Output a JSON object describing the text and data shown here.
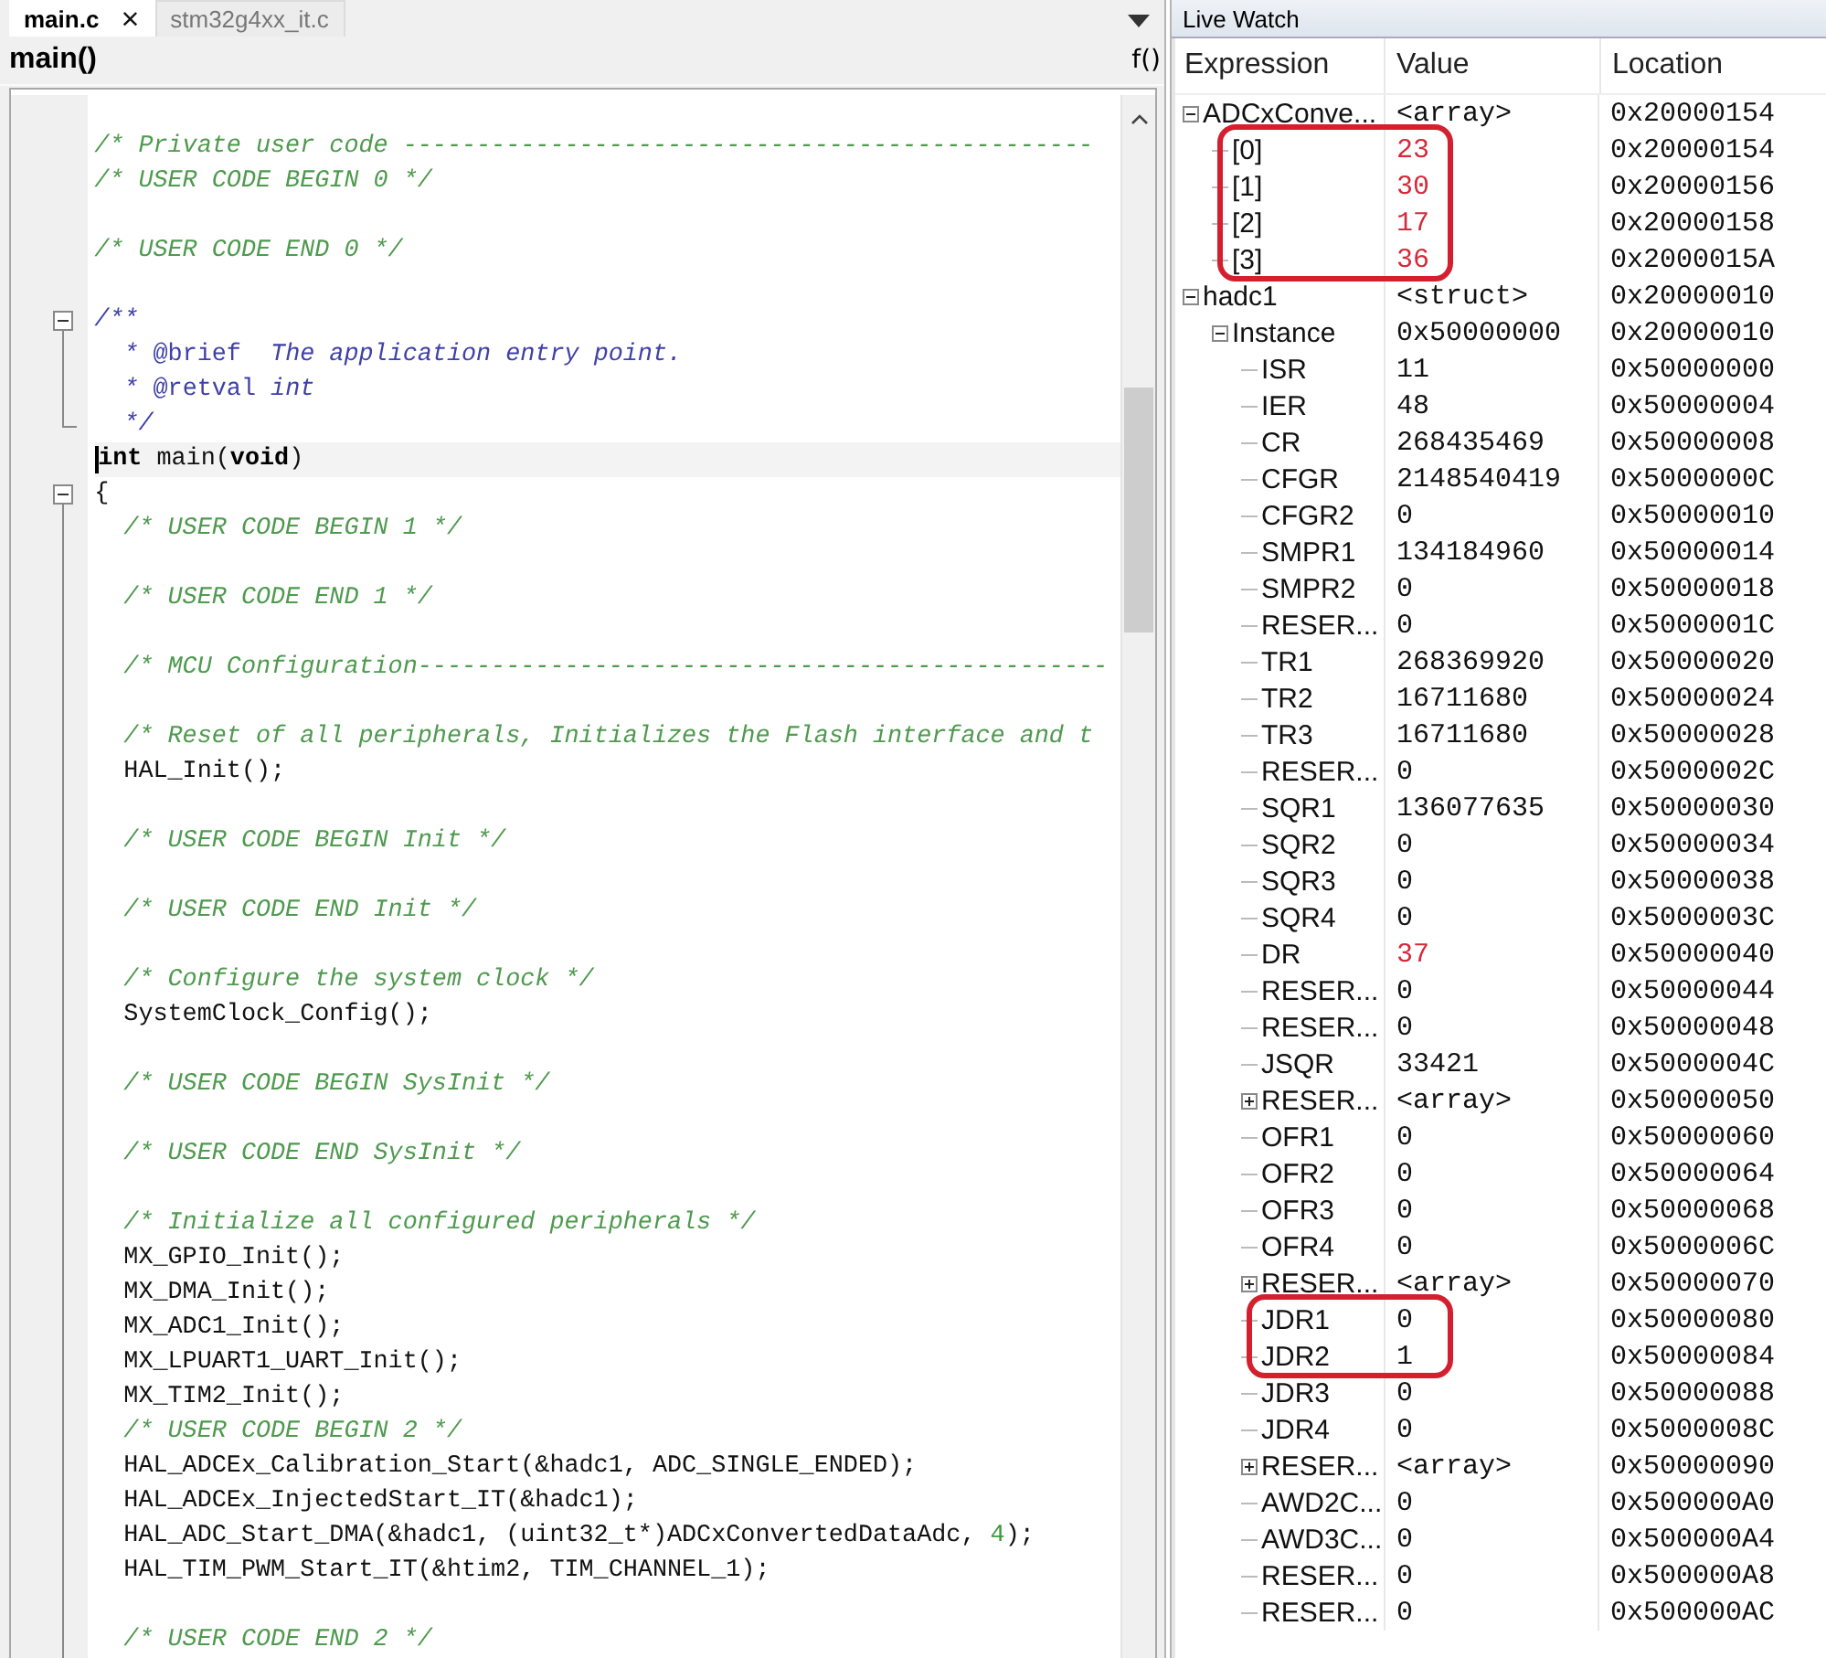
{
  "editor": {
    "tabs": [
      {
        "label": "main.c",
        "close": "×",
        "selected": true
      },
      {
        "label": "stm32g4xx_it.c",
        "selected": false
      }
    ],
    "function_name": "main()",
    "function_button": "f()",
    "lines": [
      {
        "kind": "blank",
        "current": false
      },
      {
        "kind": "text",
        "current": false,
        "segments": [
          {
            "kind": "comment",
            "text": "/* Private user code -----------------------------------------------"
          }
        ]
      },
      {
        "kind": "text",
        "current": false,
        "segments": [
          {
            "kind": "comment",
            "text": "/* USER CODE BEGIN 0 */"
          }
        ]
      },
      {
        "kind": "blank",
        "current": false
      },
      {
        "kind": "text",
        "current": false,
        "segments": [
          {
            "kind": "comment",
            "text": "/* USER CODE END 0 */"
          }
        ]
      },
      {
        "kind": "blank",
        "current": false
      },
      {
        "kind": "text",
        "current": false,
        "fold_open": true,
        "segments": [
          {
            "kind": "doc",
            "text": "/**"
          }
        ]
      },
      {
        "kind": "text",
        "current": false,
        "segments": [
          {
            "kind": "doc",
            "text": "  * "
          },
          {
            "kind": "doctag",
            "text": "@brief"
          },
          {
            "kind": "doc",
            "text": "  The application entry point."
          }
        ]
      },
      {
        "kind": "text",
        "current": false,
        "segments": [
          {
            "kind": "doc",
            "text": "  * "
          },
          {
            "kind": "doctag",
            "text": "@retval"
          },
          {
            "kind": "doc",
            "text": " int"
          }
        ]
      },
      {
        "kind": "text",
        "current": false,
        "fold_end": true,
        "segments": [
          {
            "kind": "doc",
            "text": "  */"
          }
        ]
      },
      {
        "kind": "text",
        "current": true,
        "segments": [
          {
            "kind": "keyword",
            "text": "int"
          },
          {
            "kind": "plain",
            "text": " main("
          },
          {
            "kind": "keyword",
            "text": "void"
          },
          {
            "kind": "plain",
            "text": ")"
          }
        ]
      },
      {
        "kind": "text",
        "current": false,
        "fold_open": true,
        "segments": [
          {
            "kind": "plain",
            "text": "{"
          }
        ]
      },
      {
        "kind": "text",
        "current": false,
        "segments": [
          {
            "kind": "comment",
            "text": "  /* USER CODE BEGIN 1 */"
          }
        ]
      },
      {
        "kind": "blank",
        "current": false
      },
      {
        "kind": "text",
        "current": false,
        "segments": [
          {
            "kind": "comment",
            "text": "  /* USER CODE END 1 */"
          }
        ]
      },
      {
        "kind": "blank",
        "current": false
      },
      {
        "kind": "text",
        "current": false,
        "segments": [
          {
            "kind": "comment",
            "text": "  /* MCU Configuration-----------------------------------------------"
          }
        ]
      },
      {
        "kind": "blank",
        "current": false
      },
      {
        "kind": "text",
        "current": false,
        "segments": [
          {
            "kind": "comment",
            "text": "  /* Reset of all peripherals, Initializes the Flash interface and t"
          }
        ]
      },
      {
        "kind": "text",
        "current": false,
        "segments": [
          {
            "kind": "plain",
            "text": "  HAL_Init();"
          }
        ]
      },
      {
        "kind": "blank",
        "current": false
      },
      {
        "kind": "text",
        "current": false,
        "segments": [
          {
            "kind": "comment",
            "text": "  /* USER CODE BEGIN Init */"
          }
        ]
      },
      {
        "kind": "blank",
        "current": false
      },
      {
        "kind": "text",
        "current": false,
        "segments": [
          {
            "kind": "comment",
            "text": "  /* USER CODE END Init */"
          }
        ]
      },
      {
        "kind": "blank",
        "current": false
      },
      {
        "kind": "text",
        "current": false,
        "segments": [
          {
            "kind": "comment",
            "text": "  /* Configure the system clock */"
          }
        ]
      },
      {
        "kind": "text",
        "current": false,
        "segments": [
          {
            "kind": "plain",
            "text": "  SystemClock_Config();"
          }
        ]
      },
      {
        "kind": "blank",
        "current": false
      },
      {
        "kind": "text",
        "current": false,
        "segments": [
          {
            "kind": "comment",
            "text": "  /* USER CODE BEGIN SysInit */"
          }
        ]
      },
      {
        "kind": "blank",
        "current": false
      },
      {
        "kind": "text",
        "current": false,
        "segments": [
          {
            "kind": "comment",
            "text": "  /* USER CODE END SysInit */"
          }
        ]
      },
      {
        "kind": "blank",
        "current": false
      },
      {
        "kind": "text",
        "current": false,
        "segments": [
          {
            "kind": "comment",
            "text": "  /* Initialize all configured peripherals */"
          }
        ]
      },
      {
        "kind": "text",
        "current": false,
        "segments": [
          {
            "kind": "plain",
            "text": "  MX_GPIO_Init();"
          }
        ]
      },
      {
        "kind": "text",
        "current": false,
        "segments": [
          {
            "kind": "plain",
            "text": "  MX_DMA_Init();"
          }
        ]
      },
      {
        "kind": "text",
        "current": false,
        "segments": [
          {
            "kind": "plain",
            "text": "  MX_ADC1_Init();"
          }
        ]
      },
      {
        "kind": "text",
        "current": false,
        "segments": [
          {
            "kind": "plain",
            "text": "  MX_LPUART1_UART_Init();"
          }
        ]
      },
      {
        "kind": "text",
        "current": false,
        "segments": [
          {
            "kind": "plain",
            "text": "  MX_TIM2_Init();"
          }
        ]
      },
      {
        "kind": "text",
        "current": false,
        "segments": [
          {
            "kind": "comment",
            "text": "  /* USER CODE BEGIN 2 */"
          }
        ]
      },
      {
        "kind": "text",
        "current": false,
        "segments": [
          {
            "kind": "plain",
            "text": "  HAL_ADCEx_Calibration_Start(&hadc1, ADC_SINGLE_ENDED);"
          }
        ]
      },
      {
        "kind": "text",
        "current": false,
        "segments": [
          {
            "kind": "plain",
            "text": "  HAL_ADCEx_InjectedStart_IT(&hadc1);"
          }
        ]
      },
      {
        "kind": "text",
        "current": false,
        "segments": [
          {
            "kind": "plain",
            "text": "  HAL_ADC_Start_DMA(&hadc1, (uint32_t*)ADCxConvertedDataAdc, "
          },
          {
            "kind": "number",
            "text": "4"
          },
          {
            "kind": "plain",
            "text": ");"
          }
        ]
      },
      {
        "kind": "text",
        "current": false,
        "segments": [
          {
            "kind": "plain",
            "text": "  HAL_TIM_PWM_Start_IT(&htim2, TIM_CHANNEL_1);"
          }
        ]
      },
      {
        "kind": "blank",
        "current": false
      },
      {
        "kind": "text",
        "current": false,
        "segments": [
          {
            "kind": "comment",
            "text": "  /* USER CODE END 2 */"
          }
        ]
      }
    ]
  },
  "watch": {
    "title": "Live Watch",
    "columns": [
      "Expression",
      "Value",
      "Location"
    ],
    "rows": [
      {
        "expression": "ADCxConve...",
        "value": "<array>",
        "location": "0x20000154",
        "changed": false,
        "circled": false,
        "expanded": true,
        "children": [
          {
            "expression": "[0]",
            "value": "23",
            "location": "0x20000154",
            "changed": true,
            "circled": true
          },
          {
            "expression": "[1]",
            "value": "30",
            "location": "0x20000156",
            "changed": true,
            "circled": true
          },
          {
            "expression": "[2]",
            "value": "17",
            "location": "0x20000158",
            "changed": true,
            "circled": true
          },
          {
            "expression": "[3]",
            "value": "36",
            "location": "0x2000015A",
            "changed": true,
            "circled": true
          }
        ]
      },
      {
        "expression": "hadc1",
        "value": "<struct>",
        "location": "0x20000010",
        "changed": false,
        "circled": false,
        "expanded": true,
        "children": [
          {
            "expression": "Instance",
            "value": "0x50000000",
            "location": "0x20000010",
            "changed": false,
            "circled": false,
            "expanded": true,
            "children": [
              {
                "expression": "ISR",
                "value": "11",
                "location": "0x50000000",
                "changed": false,
                "circled": false
              },
              {
                "expression": "IER",
                "value": "48",
                "location": "0x50000004",
                "changed": false,
                "circled": false
              },
              {
                "expression": "CR",
                "value": "268435469",
                "location": "0x50000008",
                "changed": false,
                "circled": false
              },
              {
                "expression": "CFGR",
                "value": "2148540419",
                "location": "0x5000000C",
                "changed": false,
                "circled": false
              },
              {
                "expression": "CFGR2",
                "value": "0",
                "location": "0x50000010",
                "changed": false,
                "circled": false
              },
              {
                "expression": "SMPR1",
                "value": "134184960",
                "location": "0x50000014",
                "changed": false,
                "circled": false
              },
              {
                "expression": "SMPR2",
                "value": "0",
                "location": "0x50000018",
                "changed": false,
                "circled": false
              },
              {
                "expression": "RESER...",
                "value": "0",
                "location": "0x5000001C",
                "changed": false,
                "circled": false
              },
              {
                "expression": "TR1",
                "value": "268369920",
                "location": "0x50000020",
                "changed": false,
                "circled": false
              },
              {
                "expression": "TR2",
                "value": "16711680",
                "location": "0x50000024",
                "changed": false,
                "circled": false
              },
              {
                "expression": "TR3",
                "value": "16711680",
                "location": "0x50000028",
                "changed": false,
                "circled": false
              },
              {
                "expression": "RESER...",
                "value": "0",
                "location": "0x5000002C",
                "changed": false,
                "circled": false
              },
              {
                "expression": "SQR1",
                "value": "136077635",
                "location": "0x50000030",
                "changed": false,
                "circled": false
              },
              {
                "expression": "SQR2",
                "value": "0",
                "location": "0x50000034",
                "changed": false,
                "circled": false
              },
              {
                "expression": "SQR3",
                "value": "0",
                "location": "0x50000038",
                "changed": false,
                "circled": false
              },
              {
                "expression": "SQR4",
                "value": "0",
                "location": "0x5000003C",
                "changed": false,
                "circled": false
              },
              {
                "expression": "DR",
                "value": "37",
                "location": "0x50000040",
                "changed": true,
                "circled": false
              },
              {
                "expression": "RESER...",
                "value": "0",
                "location": "0x50000044",
                "changed": false,
                "circled": false
              },
              {
                "expression": "RESER...",
                "value": "0",
                "location": "0x50000048",
                "changed": false,
                "circled": false
              },
              {
                "expression": "JSQR",
                "value": "33421",
                "location": "0x5000004C",
                "changed": false,
                "circled": false
              },
              {
                "expression": "RESER...",
                "value": "<array>",
                "location": "0x50000050",
                "changed": false,
                "circled": false,
                "expanded": false
              },
              {
                "expression": "OFR1",
                "value": "0",
                "location": "0x50000060",
                "changed": false,
                "circled": false
              },
              {
                "expression": "OFR2",
                "value": "0",
                "location": "0x50000064",
                "changed": false,
                "circled": false
              },
              {
                "expression": "OFR3",
                "value": "0",
                "location": "0x50000068",
                "changed": false,
                "circled": false
              },
              {
                "expression": "OFR4",
                "value": "0",
                "location": "0x5000006C",
                "changed": false,
                "circled": false
              },
              {
                "expression": "RESER...",
                "value": "<array>",
                "location": "0x50000070",
                "changed": false,
                "circled": false,
                "expanded": false
              },
              {
                "expression": "JDR1",
                "value": "0",
                "location": "0x50000080",
                "changed": false,
                "circled": true
              },
              {
                "expression": "JDR2",
                "value": "1",
                "location": "0x50000084",
                "changed": false,
                "circled": true
              },
              {
                "expression": "JDR3",
                "value": "0",
                "location": "0x50000088",
                "changed": false,
                "circled": false
              },
              {
                "expression": "JDR4",
                "value": "0",
                "location": "0x5000008C",
                "changed": false,
                "circled": false
              },
              {
                "expression": "RESER...",
                "value": "<array>",
                "location": "0x50000090",
                "changed": false,
                "circled": false,
                "expanded": false
              },
              {
                "expression": "AWD2C...",
                "value": "0",
                "location": "0x500000A0",
                "changed": false,
                "circled": false
              },
              {
                "expression": "AWD3C...",
                "value": "0",
                "location": "0x500000A4",
                "changed": false,
                "circled": false
              },
              {
                "expression": "RESER...",
                "value": "0",
                "location": "0x500000A8",
                "changed": false,
                "circled": false
              },
              {
                "expression": "RESER...",
                "value": "0",
                "location": "0x500000AC",
                "changed": false,
                "circled": false
              }
            ]
          }
        ]
      }
    ]
  }
}
